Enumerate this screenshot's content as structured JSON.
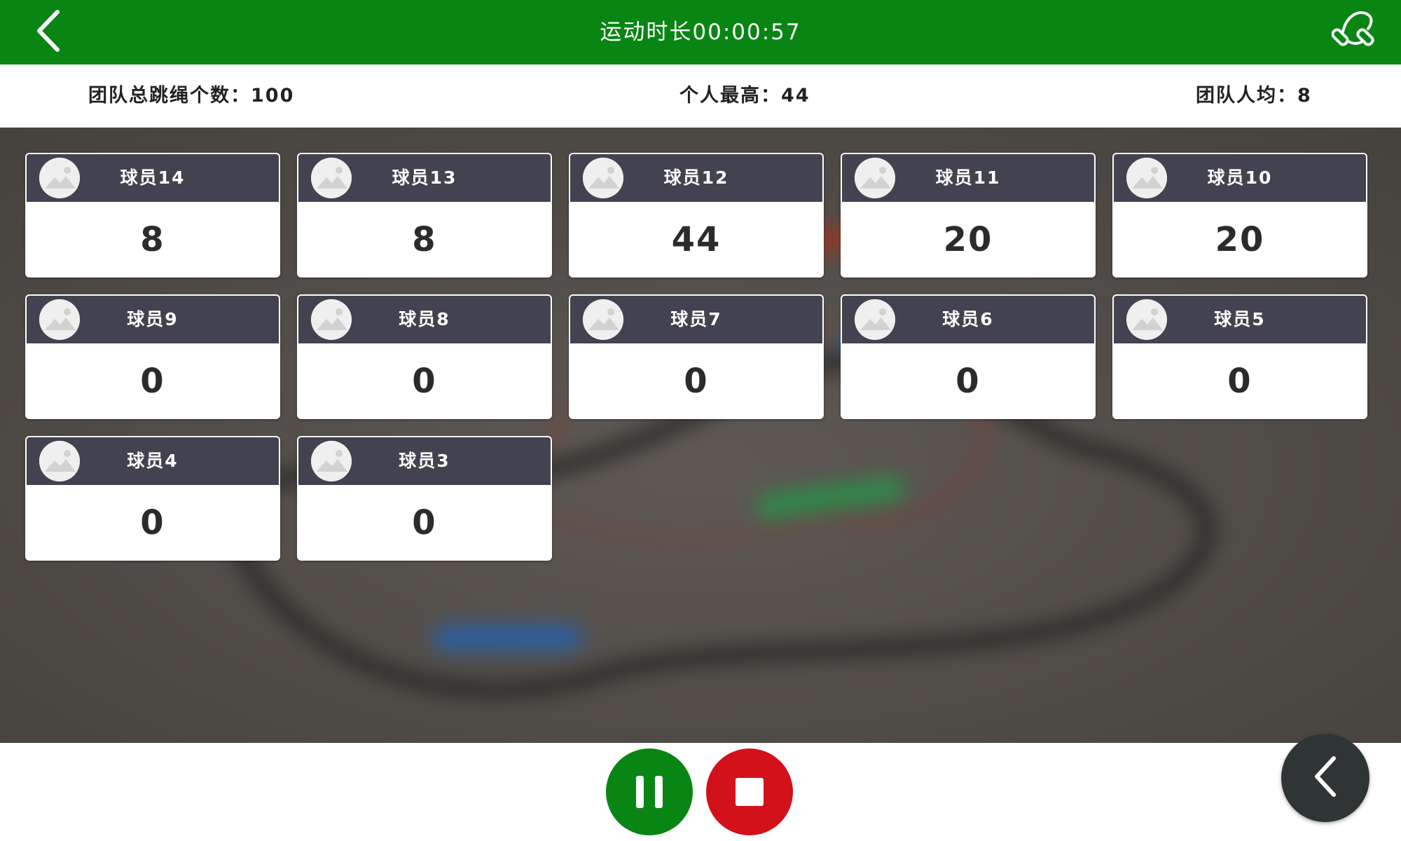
{
  "header": {
    "title": "运动时长00:00:57",
    "back_icon": "chevron-left-icon",
    "rope_icon": "jump-rope-icon",
    "bar_color": "#098513"
  },
  "stats": {
    "team_total": "团队总跳绳个数：100",
    "personal_max": "个人最高：44",
    "team_average": "团队人均：8"
  },
  "players": [
    {
      "name": "球员14",
      "count": "8"
    },
    {
      "name": "球员13",
      "count": "8"
    },
    {
      "name": "球员12",
      "count": "44"
    },
    {
      "name": "球员11",
      "count": "20"
    },
    {
      "name": "球员10",
      "count": "20"
    },
    {
      "name": "球员9",
      "count": "0"
    },
    {
      "name": "球员8",
      "count": "0"
    },
    {
      "name": "球员7",
      "count": "0"
    },
    {
      "name": "球员6",
      "count": "0"
    },
    {
      "name": "球员5",
      "count": "0"
    },
    {
      "name": "球员4",
      "count": "0"
    },
    {
      "name": "球员3",
      "count": "0"
    }
  ],
  "controls": {
    "pause_icon": "pause-icon",
    "stop_icon": "stop-icon",
    "collapse_icon": "chevron-left-icon",
    "pause_color": "#098513",
    "stop_color": "#d3111b"
  }
}
